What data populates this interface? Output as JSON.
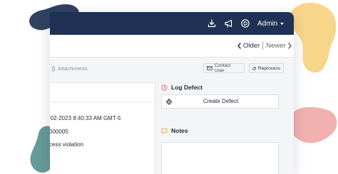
{
  "colors": {
    "header": "#1f3154",
    "blob_navy": "#1f3154",
    "blob_yellow": "#f7d68a",
    "blob_pink": "#efa9a5",
    "blob_teal": "#4a8a86",
    "log_defect_icon": "#e05d5d",
    "notes_icon": "#e5a93b"
  },
  "header": {
    "icons": [
      "download-icon",
      "megaphone-icon",
      "help-circle-icon"
    ],
    "admin_label": "Admin"
  },
  "pager": {
    "older_label": "Older",
    "newer_label": "Newer"
  },
  "actions": {
    "attachments_label": "Attachments",
    "contact_user_label": "Contact User",
    "reprocess_label": "Reprocess"
  },
  "details": {
    "datetime": "-02-2023 8:40:33 AM GMT-5",
    "id": "000005",
    "violation": "cess violation"
  },
  "sidebar": {
    "log_defect_title": "Log Defect",
    "create_defect_label": "Create Defect",
    "notes_title": "Notes"
  }
}
